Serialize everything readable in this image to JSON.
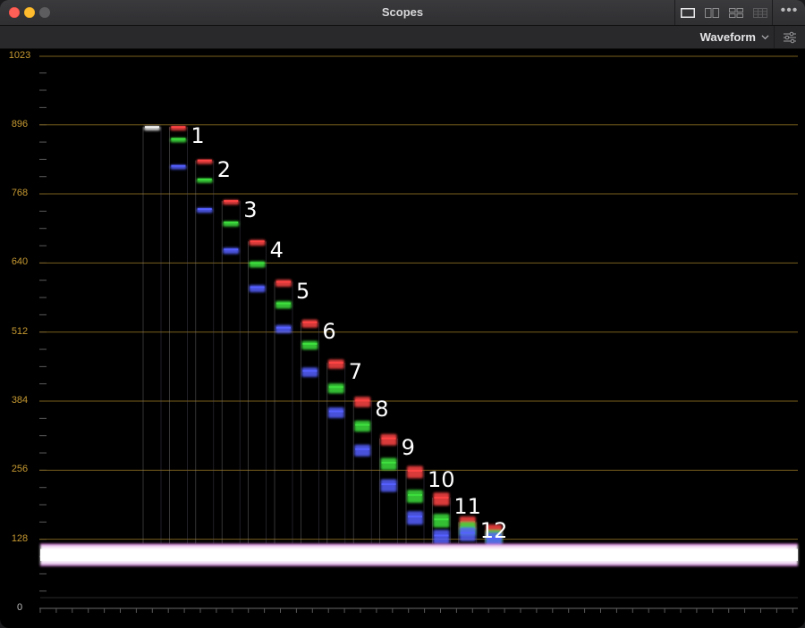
{
  "window": {
    "title": "Scopes"
  },
  "toolbar": {
    "mode": "Waveform",
    "layout_buttons": [
      "single",
      "dual",
      "quad-2x2",
      "quad-grid"
    ]
  },
  "scope": {
    "axis_labels": [
      "1023",
      "896",
      "768",
      "640",
      "512",
      "384",
      "256",
      "128",
      "0"
    ],
    "axis_values": [
      1023,
      896,
      768,
      640,
      512,
      384,
      256,
      128,
      0
    ],
    "grid_color": "#7a5f1e",
    "label_color": "#c79a32",
    "swatch_labels": [
      "1",
      "2",
      "3",
      "4",
      "5",
      "6",
      "7",
      "8",
      "9",
      "10",
      "11",
      "12"
    ],
    "steps": [
      {
        "r": 892,
        "g": 892,
        "b": 892
      },
      {
        "r": 892,
        "g": 870,
        "b": 820
      },
      {
        "r": 830,
        "g": 795,
        "b": 740
      },
      {
        "r": 755,
        "g": 715,
        "b": 665
      },
      {
        "r": 680,
        "g": 640,
        "b": 595
      },
      {
        "r": 605,
        "g": 565,
        "b": 520
      },
      {
        "r": 530,
        "g": 490,
        "b": 440
      },
      {
        "r": 455,
        "g": 410,
        "b": 365
      },
      {
        "r": 385,
        "g": 340,
        "b": 295
      },
      {
        "r": 315,
        "g": 270,
        "b": 230
      },
      {
        "r": 255,
        "g": 210,
        "b": 170
      },
      {
        "r": 205,
        "g": 165,
        "b": 135
      },
      {
        "r": 160,
        "g": 150,
        "b": 140
      },
      {
        "r": 145,
        "g": 135,
        "b": 130
      }
    ],
    "floor": {
      "low": 78,
      "high": 120
    }
  }
}
